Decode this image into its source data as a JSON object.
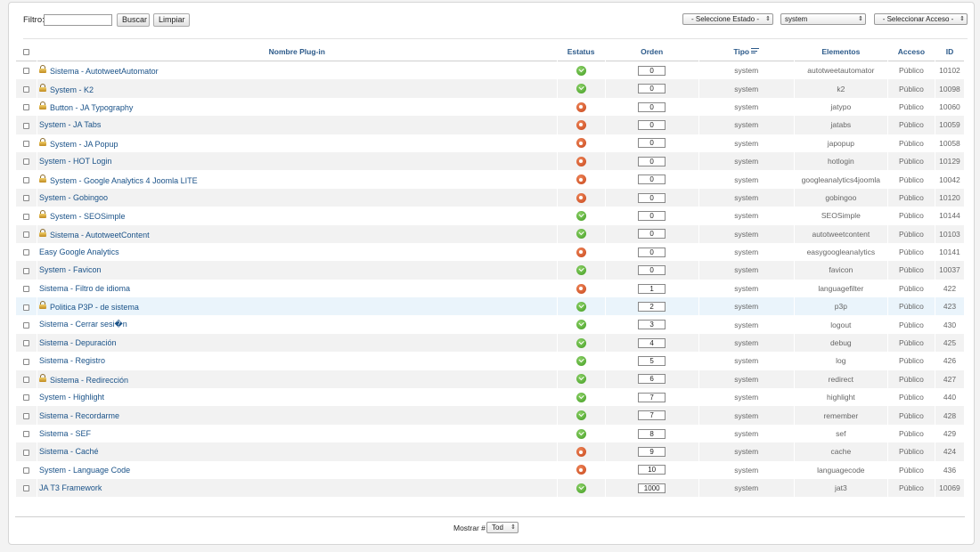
{
  "filter": {
    "label": "Filtro:",
    "value": "",
    "search_label": "Buscar",
    "clear_label": "Limpiar",
    "state_select": "- Seleccione Estado -",
    "type_select": "system",
    "access_select": "- Seleccionar Acceso -"
  },
  "columns": {
    "name": "Nombre Plug-in",
    "status": "Estatus",
    "order": "Orden",
    "type": "Tipo",
    "element": "Elementos",
    "access": "Acceso",
    "id": "ID"
  },
  "rows": [
    {
      "name": "Sistema - AutotweetAutomator",
      "locked": true,
      "status": "enabled",
      "order": "0",
      "type": "system",
      "element": "autotweetautomator",
      "access": "Público",
      "id": "10102"
    },
    {
      "name": "System - K2",
      "locked": true,
      "status": "enabled",
      "order": "0",
      "type": "system",
      "element": "k2",
      "access": "Público",
      "id": "10098"
    },
    {
      "name": "Button - JA Typography",
      "locked": true,
      "status": "disabled",
      "order": "0",
      "type": "system",
      "element": "jatypo",
      "access": "Público",
      "id": "10060"
    },
    {
      "name": "System - JA Tabs",
      "locked": false,
      "status": "disabled",
      "order": "0",
      "type": "system",
      "element": "jatabs",
      "access": "Público",
      "id": "10059"
    },
    {
      "name": "System - JA Popup",
      "locked": true,
      "status": "disabled",
      "order": "0",
      "type": "system",
      "element": "japopup",
      "access": "Público",
      "id": "10058"
    },
    {
      "name": "System - HOT Login",
      "locked": false,
      "status": "disabled",
      "order": "0",
      "type": "system",
      "element": "hotlogin",
      "access": "Público",
      "id": "10129"
    },
    {
      "name": "System - Google Analytics 4 Joomla LITE",
      "locked": true,
      "status": "disabled",
      "order": "0",
      "type": "system",
      "element": "googleanalytics4joomla",
      "access": "Público",
      "id": "10042"
    },
    {
      "name": "System - Gobingoo",
      "locked": false,
      "status": "disabled",
      "order": "0",
      "type": "system",
      "element": "gobingoo",
      "access": "Público",
      "id": "10120"
    },
    {
      "name": "System - SEOSimple",
      "locked": true,
      "status": "enabled",
      "order": "0",
      "type": "system",
      "element": "SEOSimple",
      "access": "Público",
      "id": "10144"
    },
    {
      "name": "Sistema - AutotweetContent",
      "locked": true,
      "status": "enabled",
      "order": "0",
      "type": "system",
      "element": "autotweetcontent",
      "access": "Público",
      "id": "10103"
    },
    {
      "name": "Easy Google Analytics",
      "locked": false,
      "status": "disabled",
      "order": "0",
      "type": "system",
      "element": "easygoogleanalytics",
      "access": "Público",
      "id": "10141"
    },
    {
      "name": "System - Favicon",
      "locked": false,
      "status": "enabled",
      "order": "0",
      "type": "system",
      "element": "favicon",
      "access": "Público",
      "id": "10037"
    },
    {
      "name": "Sistema - Filtro de idioma",
      "locked": false,
      "status": "disabled",
      "order": "1",
      "type": "system",
      "element": "languagefilter",
      "access": "Público",
      "id": "422"
    },
    {
      "name": "Politica P3P - de sistema",
      "locked": true,
      "status": "enabled",
      "order": "2",
      "type": "system",
      "element": "p3p",
      "access": "Público",
      "id": "423"
    },
    {
      "name": "Sistema - Cerrar sesi�n",
      "locked": false,
      "status": "enabled",
      "order": "3",
      "type": "system",
      "element": "logout",
      "access": "Público",
      "id": "430"
    },
    {
      "name": "Sistema - Depuración",
      "locked": false,
      "status": "enabled",
      "order": "4",
      "type": "system",
      "element": "debug",
      "access": "Público",
      "id": "425"
    },
    {
      "name": "Sistema - Registro",
      "locked": false,
      "status": "enabled",
      "order": "5",
      "type": "system",
      "element": "log",
      "access": "Público",
      "id": "426"
    },
    {
      "name": "Sistema - Redirección",
      "locked": true,
      "status": "enabled",
      "order": "6",
      "type": "system",
      "element": "redirect",
      "access": "Público",
      "id": "427"
    },
    {
      "name": "System - Highlight",
      "locked": false,
      "status": "enabled",
      "order": "7",
      "type": "system",
      "element": "highlight",
      "access": "Público",
      "id": "440"
    },
    {
      "name": "Sistema - Recordarme",
      "locked": false,
      "status": "enabled",
      "order": "7",
      "type": "system",
      "element": "remember",
      "access": "Público",
      "id": "428"
    },
    {
      "name": "Sistema - SEF",
      "locked": false,
      "status": "enabled",
      "order": "8",
      "type": "system",
      "element": "sef",
      "access": "Público",
      "id": "429"
    },
    {
      "name": "Sistema - Caché",
      "locked": false,
      "status": "disabled",
      "order": "9",
      "type": "system",
      "element": "cache",
      "access": "Público",
      "id": "424"
    },
    {
      "name": "System - Language Code",
      "locked": false,
      "status": "disabled",
      "order": "10",
      "type": "system",
      "element": "languagecode",
      "access": "Público",
      "id": "436"
    },
    {
      "name": "JA T3 Framework",
      "locked": false,
      "status": "enabled",
      "order": "1000",
      "type": "system",
      "element": "jat3",
      "access": "Público",
      "id": "10069"
    }
  ],
  "pagination": {
    "label": "Mostrar #",
    "limit": "Tod"
  },
  "colors": {
    "enabled": "#3e9a1e",
    "disabled": "#c5451a",
    "link": "#1a5288",
    "header": "#2c5a8a"
  }
}
